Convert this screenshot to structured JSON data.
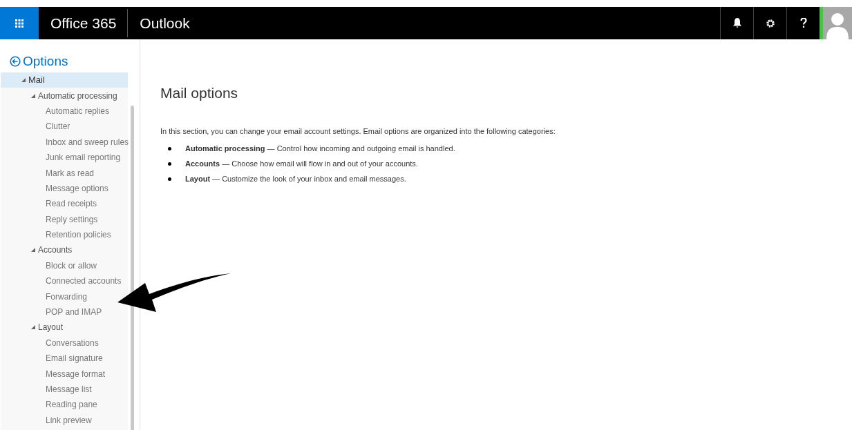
{
  "header": {
    "brand": "Office 365",
    "app": "Outlook"
  },
  "back_link": "Options",
  "tree": [
    {
      "label": "Mail",
      "selected": true,
      "expanded": true,
      "children": [
        {
          "label": "Automatic processing",
          "selected": false,
          "expanded": true,
          "children": [
            {
              "label": "Automatic replies",
              "selected": false
            },
            {
              "label": "Clutter",
              "selected": false
            },
            {
              "label": "Inbox and sweep rules",
              "selected": false
            },
            {
              "label": "Junk email reporting",
              "selected": false
            },
            {
              "label": "Mark as read",
              "selected": false
            },
            {
              "label": "Message options",
              "selected": false
            },
            {
              "label": "Read receipts",
              "selected": false
            },
            {
              "label": "Reply settings",
              "selected": false
            },
            {
              "label": "Retention policies",
              "selected": false
            }
          ]
        },
        {
          "label": "Accounts",
          "selected": false,
          "expanded": true,
          "children": [
            {
              "label": "Block or allow",
              "selected": false
            },
            {
              "label": "Connected accounts",
              "selected": false
            },
            {
              "label": "Forwarding",
              "selected": false
            },
            {
              "label": "POP and IMAP",
              "selected": false
            }
          ]
        },
        {
          "label": "Layout",
          "selected": false,
          "expanded": true,
          "children": [
            {
              "label": "Conversations",
              "selected": false
            },
            {
              "label": "Email signature",
              "selected": false
            },
            {
              "label": "Message format",
              "selected": false
            },
            {
              "label": "Message list",
              "selected": false
            },
            {
              "label": "Reading pane",
              "selected": false
            },
            {
              "label": "Link preview",
              "selected": false
            }
          ]
        }
      ]
    }
  ],
  "main": {
    "title": "Mail options",
    "intro": "In this section, you can change your email account settings. Email options are organized into the following categories:",
    "bullets": [
      "**Automatic processing** — Control how incoming and outgoing email is handled.",
      "**Accounts** — Choose how email will flow in and out of your accounts.",
      "**Layout** — Customize the look of your inbox and email messages."
    ]
  }
}
